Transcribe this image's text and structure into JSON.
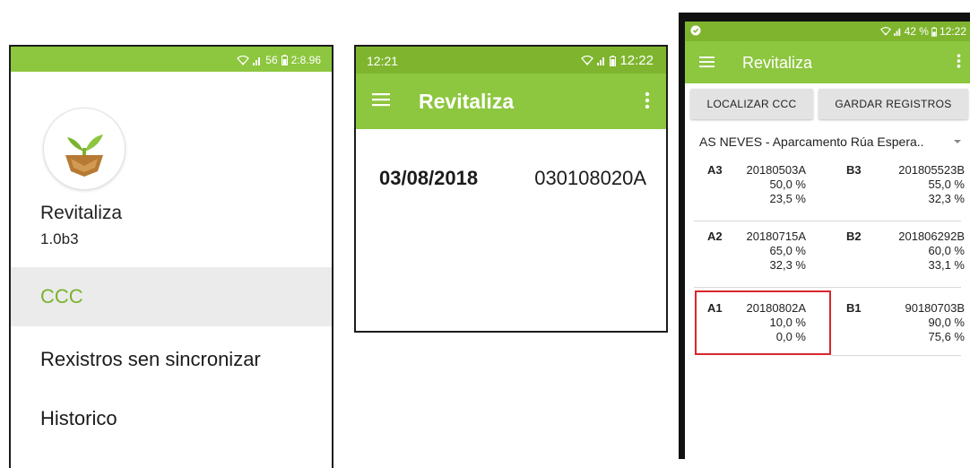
{
  "screen1": {
    "status": {
      "time": "2:8.96",
      "battery": "56"
    },
    "header": {
      "app_name": "Revitaliza",
      "app_version": "1.0b3"
    },
    "menu": [
      {
        "label": "CCC",
        "active": true
      },
      {
        "label": "Rexistros sen sincronizar",
        "active": false
      },
      {
        "label": "Historico",
        "active": false
      }
    ]
  },
  "screen2": {
    "status": {
      "time_left": "12:21",
      "time_right": "12:22"
    },
    "appbar": {
      "title": "Revitaliza"
    },
    "record": {
      "date": "03/08/2018",
      "code": "030108020A"
    }
  },
  "screen3": {
    "status": {
      "battery": "42 %",
      "time": "12:22"
    },
    "appbar": {
      "title": "Revitaliza"
    },
    "buttons": {
      "localizar": "LOCALIZAR CCC",
      "gardar": "GARDAR REGISTROS"
    },
    "location": "AS NEVES - Aparcamento Rúa Espera..",
    "grid": [
      {
        "label": "A3",
        "code": "20180503A",
        "v1": "50,0 %",
        "v2": "23,5 %"
      },
      {
        "label": "B3",
        "code": "201805523B",
        "v1": "55,0 %",
        "v2": "32,3 %"
      },
      {
        "label": "A2",
        "code": "20180715A",
        "v1": "65,0 %",
        "v2": "32,3 %"
      },
      {
        "label": "B2",
        "code": "201806292B",
        "v1": "60,0 %",
        "v2": "33,1 %"
      },
      {
        "label": "A1",
        "code": "20180802A",
        "v1": "10,0 %",
        "v2": "0,0 %"
      },
      {
        "label": "B1",
        "code": "90180703B",
        "v1": "90,0 %",
        "v2": "75,6 %"
      }
    ]
  },
  "colors": {
    "primary": "#8dc63f",
    "primary_dark": "#7fb52e",
    "highlight": "#d9262c"
  }
}
